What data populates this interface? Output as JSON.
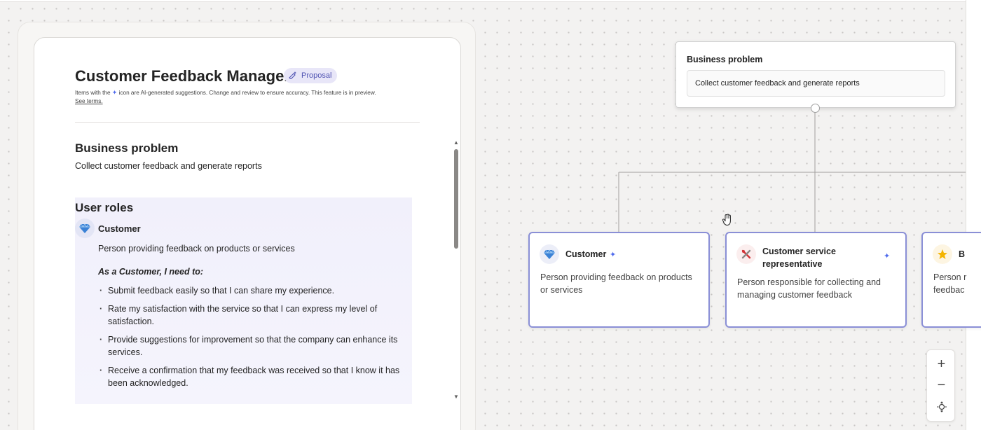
{
  "document": {
    "title": "Customer Feedback Manager",
    "badge": "Proposal",
    "disclaimer_prefix": "Items with the",
    "disclaimer_suffix": "icon are AI-generated suggestions. Change and review to ensure accuracy. This feature is in preview.",
    "see_terms": "See terms.",
    "business_problem": {
      "heading": "Business problem",
      "text": "Collect customer feedback and generate reports"
    },
    "user_roles": {
      "heading": "User roles",
      "role": {
        "icon": "gem-icon",
        "name": "Customer",
        "description": "Person providing feedback on products or services",
        "need_label": "As a Customer, I need to:",
        "needs": [
          "Submit feedback easily so that I can share my experience.",
          "Rate my satisfaction with the service so that I can express my level of satisfaction.",
          "Provide suggestions for improvement so that the company can enhance its services.",
          "Receive a confirmation that my feedback was received so that I know it has been acknowledged."
        ]
      }
    }
  },
  "canvas": {
    "business_problem_card": {
      "title": "Business problem",
      "value": "Collect customer feedback and generate reports"
    },
    "role_cards": [
      {
        "icon": "gem-icon",
        "title": "Customer",
        "description": "Person providing feedback on products or services"
      },
      {
        "icon": "tools-icon",
        "title": "Customer service representative",
        "description": "Person responsible for collecting and managing customer feedback"
      },
      {
        "icon": "star-icon",
        "title": "B",
        "description": "Person r\nfeedbac"
      }
    ],
    "zoom_controls": {
      "zoom_in": "+",
      "zoom_out": "−"
    }
  },
  "colors": {
    "accent": "#4f52b2",
    "card_border": "#8a8fd6",
    "sparkle": "#4f6bed"
  }
}
